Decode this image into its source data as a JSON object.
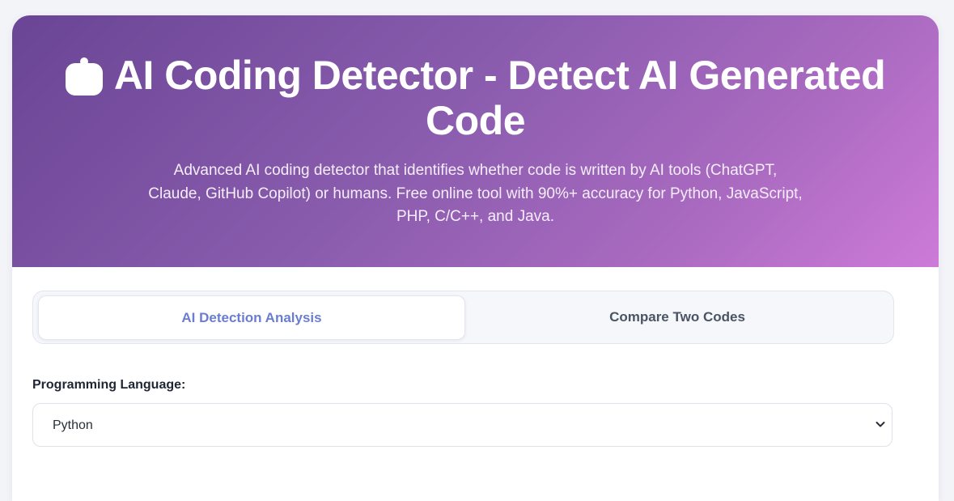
{
  "header": {
    "icon": "robot-icon",
    "title": "AI Coding Detector - Detect AI Generated Code",
    "subtitle": "Advanced AI coding detector that identifies whether code is written by AI tools (ChatGPT, Claude, GitHub Copilot) or humans. Free online tool with 90%+ accuracy for Python, JavaScript, PHP, C/C++, and Java."
  },
  "tabs": [
    {
      "label": "AI Detection Analysis",
      "active": true
    },
    {
      "label": "Compare Two Codes",
      "active": false
    }
  ],
  "language": {
    "label": "Programming Language:",
    "selected": "Python",
    "icon": "chevron-down-icon"
  },
  "colors": {
    "gradient_start": "#6a4595",
    "gradient_end": "#cd7ad8",
    "active_tab_text": "#6a7dd1",
    "inactive_tab_text": "#4a5463"
  }
}
